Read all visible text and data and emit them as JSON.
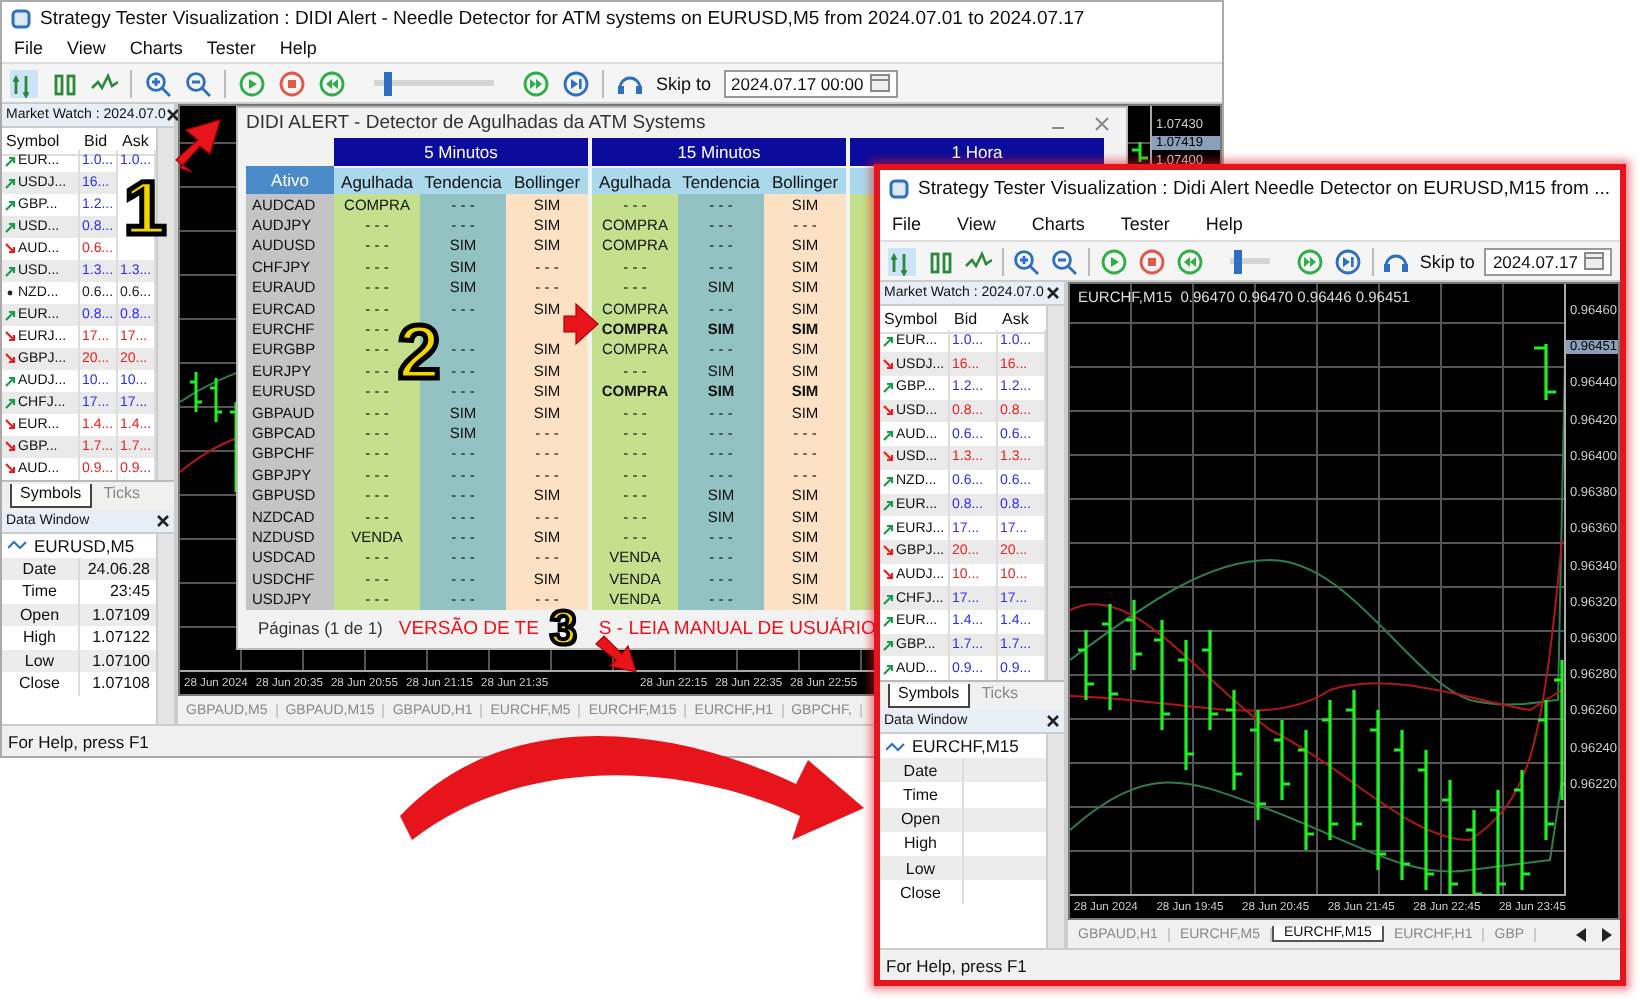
{
  "back_window": {
    "title": "Strategy Tester Visualization : DIDI Alert - Needle Detector for ATM systems on EURUSD,M5 from 2024.07.01 to 2024.07.17",
    "highlighted": false,
    "menu": [
      "File",
      "View",
      "Charts",
      "Tester",
      "Help"
    ],
    "toolbar": {
      "speed_slider": {
        "level": 0.08
      },
      "skip_label": "Skip to",
      "skip_date": "2024.07.17 00:00"
    },
    "market_watch": {
      "title": "Market Watch : 2024.07.0",
      "columns": [
        "Symbol",
        "Bid",
        "Ask"
      ],
      "rows": [
        {
          "symbol": "EUR...",
          "bid": "1.0...",
          "ask": "1.0...",
          "kind": "up"
        },
        {
          "symbol": "USDJ...",
          "bid": "16...",
          "kind": "up"
        },
        {
          "symbol": "GBP...",
          "bid": "1.2...",
          "kind": "up"
        },
        {
          "symbol": "USD...",
          "bid": "0.8...",
          "kind": "up"
        },
        {
          "symbol": "AUD...",
          "bid": "0.6...",
          "kind": "down"
        },
        {
          "symbol": "USD...",
          "bid": "1.3...",
          "ask": "1.3...",
          "kind": "up"
        },
        {
          "symbol": "NZD...",
          "bid": "0.6...",
          "ask": "0.6...",
          "kind": "flat"
        },
        {
          "symbol": "EUR...",
          "bid": "0.8...",
          "ask": "0.8...",
          "kind": "up"
        },
        {
          "symbol": "EURJ...",
          "bid": "17...",
          "ask": "17...",
          "kind": "down"
        },
        {
          "symbol": "GBPJ...",
          "bid": "20...",
          "ask": "20...",
          "kind": "down"
        },
        {
          "symbol": "AUDJ...",
          "bid": "10...",
          "ask": "10...",
          "kind": "up"
        },
        {
          "symbol": "CHFJ...",
          "bid": "17...",
          "ask": "17...",
          "kind": "up"
        },
        {
          "symbol": "EUR...",
          "bid": "1.4...",
          "ask": "1.4...",
          "kind": "down"
        },
        {
          "symbol": "GBP...",
          "bid": "1.7...",
          "ask": "1.7...",
          "kind": "down"
        },
        {
          "symbol": "AUD...",
          "bid": "0.9...",
          "ask": "0.9...",
          "kind": "down"
        }
      ]
    },
    "panel_tabs": [
      {
        "label": "Symbols",
        "selected": true
      },
      {
        "label": "Ticks",
        "selected": false
      }
    ],
    "data_window": {
      "title": "Data Window",
      "symbol": "EURUSD,M5",
      "rows": [
        {
          "label": "Date",
          "value": "24.06.28"
        },
        {
          "label": "Time",
          "value": "23:45"
        },
        {
          "label": "Open",
          "value": "1.07109"
        },
        {
          "label": "High",
          "value": "1.07122"
        },
        {
          "label": "Low",
          "value": "1.07100"
        },
        {
          "label": "Close",
          "value": "1.07108"
        }
      ]
    },
    "chart": {
      "price_labels": [
        {
          "text": "1.07430",
          "current": false
        },
        {
          "text": "1.07419",
          "current": true
        },
        {
          "text": "1.07400",
          "current": false
        }
      ],
      "time_labels": [
        "28 Jun 2024",
        "28 Jun 20:35",
        "28 Jun 20:55",
        "28 Jun 21:15",
        "28 Jun 21:35",
        "28 Jun 22:15",
        "28 Jun 22:35",
        "28 Jun 22:55"
      ]
    },
    "chart_tabs": [
      {
        "label": "GBPAUD,M5",
        "selected": false
      },
      {
        "label": "GBPAUD,M15",
        "selected": false
      },
      {
        "label": "GBPAUD,H1",
        "selected": false
      },
      {
        "label": "EURCHF,M5",
        "selected": false
      },
      {
        "label": "EURCHF,M15",
        "selected": false
      },
      {
        "label": "EURCHF,H1",
        "selected": false
      },
      {
        "label": "GBPCHF,",
        "selected": false
      }
    ],
    "status": "For Help, press F1"
  },
  "alert_panel": {
    "title": "DIDI ALERT - Detector de Agulhadas da ATM Systems",
    "asset_header": "Ativo",
    "groups": [
      {
        "label": "5 Minutos",
        "columns": [
          "Agulhada",
          "Tendencia",
          "Bollinger"
        ]
      },
      {
        "label": "15 Minutos",
        "columns": [
          "Agulhada",
          "Tendencia",
          "Bollinger"
        ]
      },
      {
        "label": "1 Hora"
      }
    ],
    "rows": [
      {
        "asset": "AUDCAD",
        "groups": [
          {
            "values": [
              "COMPRA",
              "- - -",
              "SIM"
            ],
            "bold": false
          },
          {
            "values": [
              "- - -",
              "- - -",
              "SIM"
            ],
            "bold": false
          }
        ]
      },
      {
        "asset": "AUDJPY",
        "groups": [
          {
            "values": [
              "- - -",
              "- - -",
              "SIM"
            ],
            "bold": false
          },
          {
            "values": [
              "COMPRA",
              "- - -",
              "- - -"
            ],
            "bold": false
          }
        ]
      },
      {
        "asset": "AUDUSD",
        "groups": [
          {
            "values": [
              "- - -",
              "SIM",
              "SIM"
            ],
            "bold": false
          },
          {
            "values": [
              "COMPRA",
              "- - -",
              "SIM"
            ],
            "bold": false
          }
        ]
      },
      {
        "asset": "CHFJPY",
        "groups": [
          {
            "values": [
              "- - -",
              "SIM",
              "- - -"
            ],
            "bold": false
          },
          {
            "values": [
              "- - -",
              "- - -",
              "SIM"
            ],
            "bold": false
          }
        ]
      },
      {
        "asset": "EURAUD",
        "groups": [
          {
            "values": [
              "- - -",
              "SIM",
              "- - -"
            ],
            "bold": false
          },
          {
            "values": [
              "- - -",
              "SIM",
              "SIM"
            ],
            "bold": false
          }
        ]
      },
      {
        "asset": "EURCAD",
        "groups": [
          {
            "values": [
              "- - -",
              "- - -",
              "SIM"
            ],
            "bold": false
          },
          {
            "values": [
              "COMPRA",
              "- - -",
              "SIM"
            ],
            "bold": false
          }
        ]
      },
      {
        "asset": "EURCHF",
        "groups": [
          {
            "values": [
              "- - -"
            ],
            "bold": false
          },
          {
            "values": [
              "COMPRA",
              "SIM",
              "SIM"
            ],
            "bold": true
          }
        ]
      },
      {
        "asset": "EURGBP",
        "groups": [
          {
            "values": [
              "- - -",
              "- - -",
              "SIM"
            ],
            "bold": false
          },
          {
            "values": [
              "COMPRA",
              "- - -",
              "SIM"
            ],
            "bold": false
          }
        ]
      },
      {
        "asset": "EURJPY",
        "groups": [
          {
            "values": [
              "- - -",
              "- - -",
              "SIM"
            ],
            "bold": false
          },
          {
            "values": [
              "- - -",
              "SIM",
              "SIM"
            ],
            "bold": false
          }
        ]
      },
      {
        "asset": "EURUSD",
        "groups": [
          {
            "values": [
              "- - -",
              "- - -",
              "SIM"
            ],
            "bold": false
          },
          {
            "values": [
              "COMPRA",
              "SIM",
              "SIM"
            ],
            "bold": true
          }
        ]
      },
      {
        "asset": "GBPAUD",
        "groups": [
          {
            "values": [
              "- - -",
              "SIM",
              "SIM"
            ],
            "bold": false
          },
          {
            "values": [
              "- - -",
              "- - -",
              "SIM"
            ],
            "bold": false
          }
        ]
      },
      {
        "asset": "GBPCAD",
        "groups": [
          {
            "values": [
              "- - -",
              "SIM",
              "- - -"
            ],
            "bold": false
          },
          {
            "values": [
              "- - -",
              "- - -",
              "- - -"
            ],
            "bold": false
          }
        ]
      },
      {
        "asset": "GBPCHF",
        "groups": [
          {
            "values": [
              "- - -",
              "- - -",
              "- - -"
            ],
            "bold": false
          },
          {
            "values": [
              "- - -",
              "- - -",
              "- - -"
            ],
            "bold": false
          }
        ]
      },
      {
        "asset": "GBPJPY",
        "groups": [
          {
            "values": [
              "- - -",
              "- - -",
              "- - -"
            ],
            "bold": false
          },
          {
            "values": [
              "- - -",
              "- - -",
              "- - -"
            ],
            "bold": false
          }
        ]
      },
      {
        "asset": "GBPUSD",
        "groups": [
          {
            "values": [
              "- - -",
              "- - -",
              "SIM"
            ],
            "bold": false
          },
          {
            "values": [
              "- - -",
              "SIM",
              "SIM"
            ],
            "bold": false
          }
        ]
      },
      {
        "asset": "NZDCAD",
        "groups": [
          {
            "values": [
              "- - -",
              "- - -",
              "- - -"
            ],
            "bold": false
          },
          {
            "values": [
              "- - -",
              "SIM",
              "SIM"
            ],
            "bold": false
          }
        ]
      },
      {
        "asset": "NZDUSD",
        "groups": [
          {
            "values": [
              "VENDA",
              "- - -",
              "SIM"
            ],
            "bold": false
          },
          {
            "values": [
              "- - -",
              "- - -",
              "SIM"
            ],
            "bold": false
          }
        ]
      },
      {
        "asset": "USDCAD",
        "groups": [
          {
            "values": [
              "- - -",
              "- - -",
              "- - -"
            ],
            "bold": false
          },
          {
            "values": [
              "VENDA",
              "- - -",
              "SIM"
            ],
            "bold": false
          }
        ]
      },
      {
        "asset": "USDCHF",
        "groups": [
          {
            "values": [
              "- - -",
              "- - -",
              "SIM"
            ],
            "bold": false
          },
          {
            "values": [
              "VENDA",
              "- - -",
              "SIM"
            ],
            "bold": false
          }
        ]
      },
      {
        "asset": "USDJPY",
        "groups": [
          {
            "values": [
              "- - -",
              "- - -",
              "- - -"
            ],
            "bold": false
          },
          {
            "values": [
              "VENDA",
              "- - -",
              "SIM"
            ],
            "bold": false
          }
        ]
      }
    ],
    "pages": "Páginas (1 de 1)",
    "warning_parts": [
      "VERSÃO DE TE",
      "S - LEIA MANUAL DE USUÁRIO"
    ]
  },
  "front_window": {
    "title": "Strategy Tester Visualization : Didi Alert Needle Detector on EURUSD,M15 from ...",
    "highlighted": true,
    "menu": [
      "File",
      "View",
      "Charts",
      "Tester",
      "Help"
    ],
    "toolbar": {
      "speed_slider": {
        "level": 0.1
      },
      "skip_label": "Skip to",
      "skip_date": "2024.07.17"
    },
    "market_watch": {
      "title": "Market Watch : 2024.07.0",
      "columns": [
        "Symbol",
        "Bid",
        "Ask"
      ],
      "rows": [
        {
          "symbol": "EUR...",
          "bid": "1.0...",
          "ask": "1.0...",
          "kind": "up"
        },
        {
          "symbol": "USDJ...",
          "bid": "16...",
          "ask": "16...",
          "kind": "down"
        },
        {
          "symbol": "GBP...",
          "bid": "1.2...",
          "ask": "1.2...",
          "kind": "up"
        },
        {
          "symbol": "USD...",
          "bid": "0.8...",
          "ask": "0.8...",
          "kind": "down"
        },
        {
          "symbol": "AUD...",
          "bid": "0.6...",
          "ask": "0.6...",
          "kind": "up"
        },
        {
          "symbol": "USD...",
          "bid": "1.3...",
          "ask": "1.3...",
          "kind": "down"
        },
        {
          "symbol": "NZD...",
          "bid": "0.6...",
          "ask": "0.6...",
          "kind": "up"
        },
        {
          "symbol": "EUR...",
          "bid": "0.8...",
          "ask": "0.8...",
          "kind": "up"
        },
        {
          "symbol": "EURJ...",
          "bid": "17...",
          "ask": "17...",
          "kind": "up"
        },
        {
          "symbol": "GBPJ...",
          "bid": "20...",
          "ask": "20...",
          "kind": "down"
        },
        {
          "symbol": "AUDJ...",
          "bid": "10...",
          "ask": "10...",
          "kind": "down"
        },
        {
          "symbol": "CHFJ...",
          "bid": "17...",
          "ask": "17...",
          "kind": "up"
        },
        {
          "symbol": "EUR...",
          "bid": "1.4...",
          "ask": "1.4...",
          "kind": "up"
        },
        {
          "symbol": "GBP...",
          "bid": "1.7...",
          "ask": "1.7...",
          "kind": "up"
        },
        {
          "symbol": "AUD...",
          "bid": "0.9...",
          "ask": "0.9...",
          "kind": "up"
        }
      ]
    },
    "panel_tabs": [
      {
        "label": "Symbols",
        "selected": true
      },
      {
        "label": "Ticks",
        "selected": false
      }
    ],
    "data_window": {
      "title": "Data Window",
      "symbol": "EURCHF,M15",
      "rows": [
        {
          "label": "Date"
        },
        {
          "label": "Time"
        },
        {
          "label": "Open"
        },
        {
          "label": "High"
        },
        {
          "label": "Low"
        },
        {
          "label": "Close"
        }
      ]
    },
    "chart": {
      "header": "EURCHF,M15  0.96470 0.96470 0.96446 0.96451",
      "price_labels": [
        {
          "text": "0.96460",
          "current": false
        },
        {
          "text": "0.96451",
          "current": true
        },
        {
          "text": "0.96440",
          "current": false
        },
        {
          "text": "0.96420",
          "current": false
        },
        {
          "text": "0.96400",
          "current": false
        },
        {
          "text": "0.96380",
          "current": false
        },
        {
          "text": "0.96360",
          "current": false
        },
        {
          "text": "0.96340",
          "current": false
        },
        {
          "text": "0.96320",
          "current": false
        },
        {
          "text": "0.96300",
          "current": false
        },
        {
          "text": "0.96280",
          "current": false
        },
        {
          "text": "0.96260",
          "current": false
        },
        {
          "text": "0.96240",
          "current": false
        },
        {
          "text": "0.96220",
          "current": false
        }
      ],
      "time_labels": [
        "28 Jun 2024",
        "28 Jun 19:45",
        "28 Jun 20:45",
        "28 Jun 21:45",
        "28 Jun 22:45",
        "28 Jun 23:45"
      ]
    },
    "chart_tabs": [
      {
        "label": "GBPAUD,H1",
        "selected": false
      },
      {
        "label": "EURCHF,M5",
        "selected": false
      },
      {
        "label": "EURCHF,M15",
        "selected": true
      },
      {
        "label": "EURCHF,H1",
        "selected": false
      },
      {
        "label": "GBP",
        "selected": false
      }
    ],
    "status": "For Help, press F1"
  },
  "callouts": [
    "1",
    "2",
    "3"
  ]
}
